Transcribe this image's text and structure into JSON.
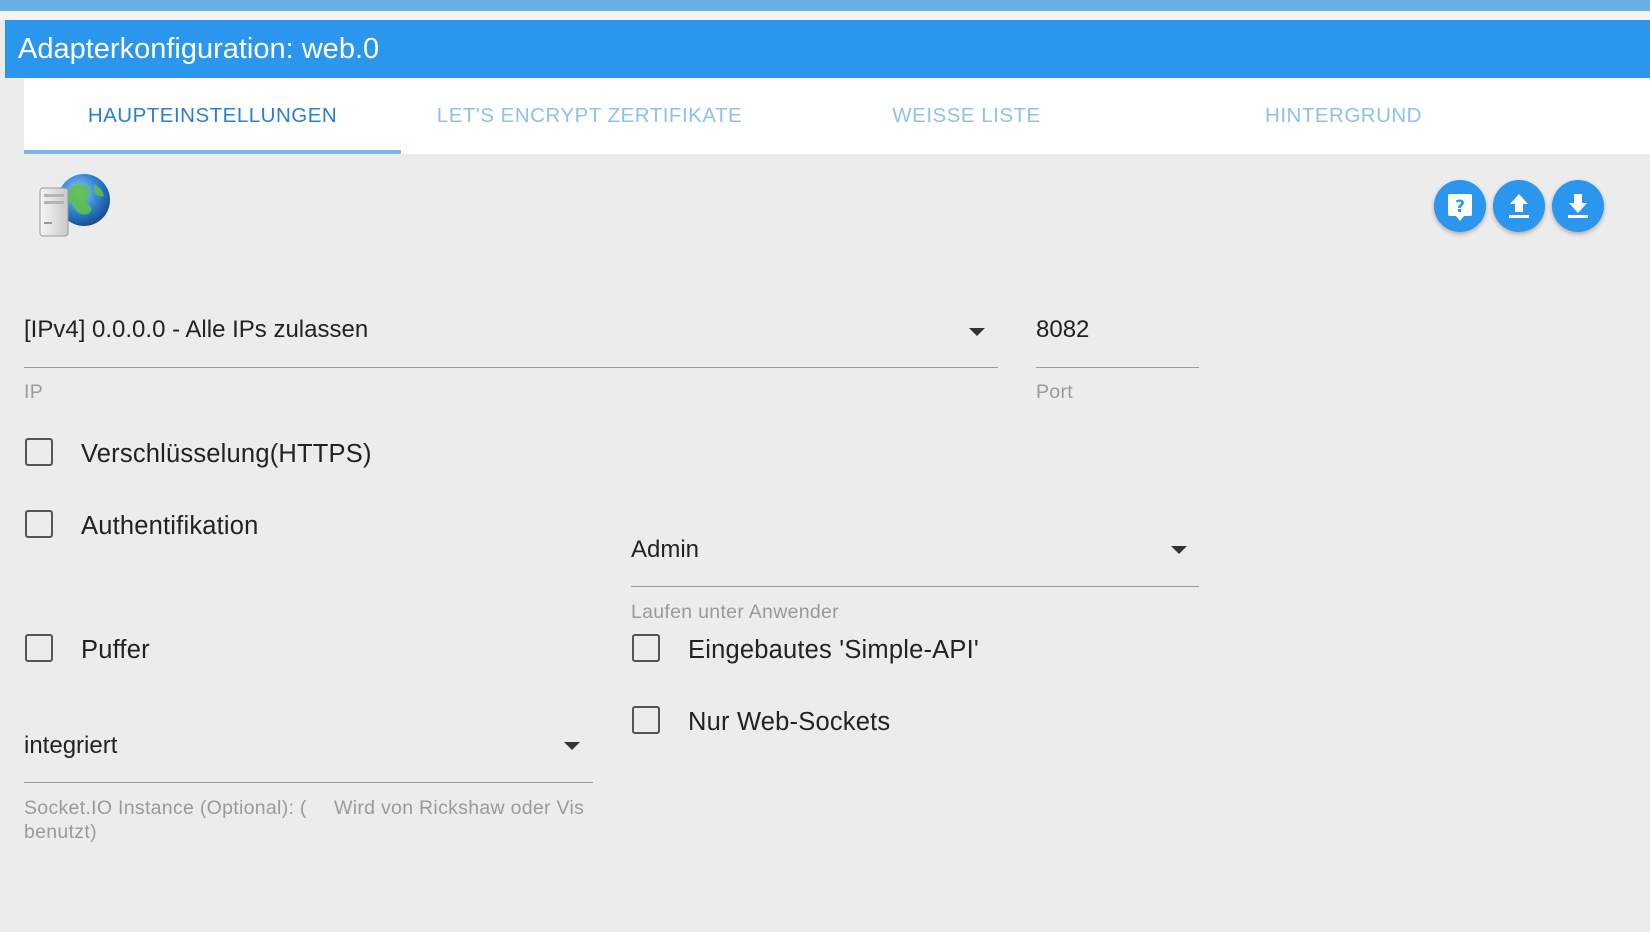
{
  "header": {
    "title": "Adapterkonfiguration: web.0"
  },
  "tabs": [
    {
      "label": "HAUPTEINSTELLUNGEN",
      "active": true
    },
    {
      "label": "LET'S ENCRYPT ZERTIFIKATE",
      "active": false
    },
    {
      "label": "WEISSE LISTE",
      "active": false
    },
    {
      "label": "HINTERGRUND",
      "active": false
    }
  ],
  "toolbar": {
    "icons": [
      "help-icon",
      "upload-icon",
      "download-icon"
    ],
    "accent": "#2b96ee"
  },
  "form": {
    "ip": {
      "value": "[IPv4] 0.0.0.0 - Alle IPs zulassen",
      "label": "IP"
    },
    "port": {
      "value": "8082",
      "label": "Port"
    },
    "https": {
      "label": "Verschlüsselung(HTTPS)",
      "checked": false
    },
    "auth": {
      "label": "Authentifikation",
      "checked": false
    },
    "run_as": {
      "value": "Admin",
      "label": "Laufen unter Anwender"
    },
    "buffer": {
      "label": "Puffer",
      "checked": false
    },
    "simple_api": {
      "label": "Eingebautes 'Simple-API'",
      "checked": false
    },
    "web_sockets": {
      "label": "Nur Web-Sockets",
      "checked": false
    },
    "socketio": {
      "value": "integriert",
      "label_part1": "Socket.IO Instance (Optional): (",
      "label_part2": "Wird von Rickshaw oder Vis",
      "label_part3": "benutzt)"
    }
  }
}
